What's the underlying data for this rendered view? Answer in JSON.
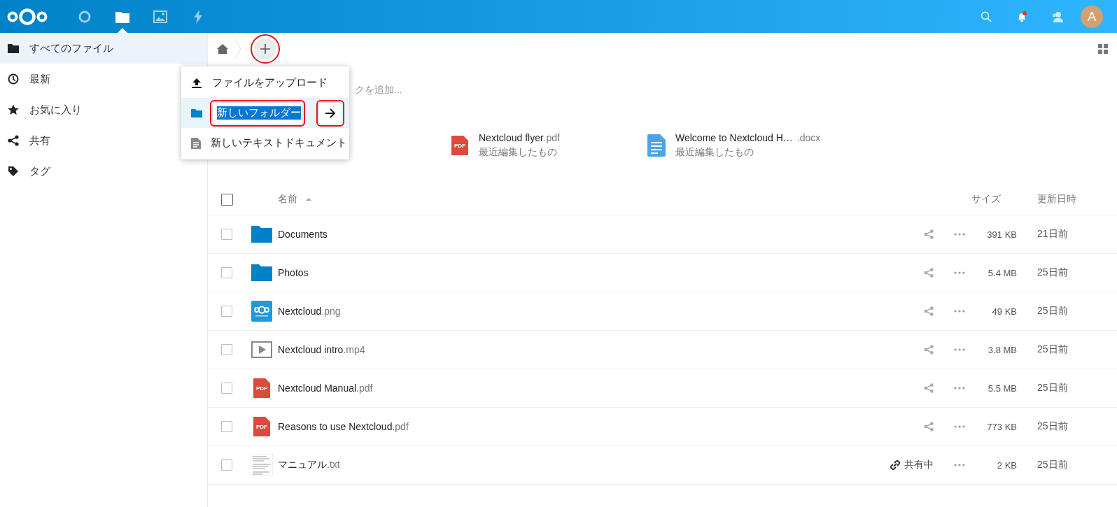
{
  "header": {
    "apps": [
      {
        "kind": "dashboard",
        "selected": false
      },
      {
        "kind": "files",
        "selected": true
      },
      {
        "kind": "photos",
        "selected": false
      },
      {
        "kind": "activity",
        "selected": false
      }
    ],
    "notifications_unread": true,
    "avatar": {
      "initial": "A"
    }
  },
  "sidebar": {
    "items": [
      {
        "kind": "all",
        "label": "すべてのファイル",
        "selected": true
      },
      {
        "kind": "recent",
        "label": "最新",
        "selected": false
      },
      {
        "kind": "favorites",
        "label": "お気に入り",
        "selected": false
      },
      {
        "kind": "shares",
        "label": "共有",
        "selected": false
      },
      {
        "kind": "tags",
        "label": "タグ",
        "selected": false
      }
    ]
  },
  "breadcrumb": {
    "new_button_highlighted": true
  },
  "new_menu": {
    "items": [
      {
        "kind": "upload",
        "label": "ファイルをアップロード",
        "selected": false
      },
      {
        "kind": "folder",
        "value": "新しいフォルダー",
        "text_selected": true,
        "highlighted": true,
        "submit_highlighted": true,
        "selected": true
      },
      {
        "kind": "text",
        "label": "新しいテキストドキュメント",
        "selected": false
      }
    ]
  },
  "description": {
    "visible_text": "クを追加..."
  },
  "recent": [
    {
      "kind": "pdf",
      "icon_text": "PDF",
      "name": "Nextcloud flyer",
      "ext": ".pdf",
      "subtitle": "最近編集したもの"
    },
    {
      "kind": "doc",
      "name": "Welcome to Nextcloud H…",
      "ext": ".docx",
      "subtitle": "最近編集したもの"
    }
  ],
  "table": {
    "select_all_checked": false,
    "columns": [
      {
        "label": "名前",
        "sorted": true
      },
      {
        "label": "サイズ",
        "sorted": false
      },
      {
        "label": "更新日時",
        "sorted": false
      }
    ],
    "rows": [
      {
        "kind": "folder",
        "name": "Documents",
        "shared": false,
        "checked": false,
        "size": "391 KB",
        "modified": "21日前"
      },
      {
        "kind": "folder",
        "name": "Photos",
        "shared": false,
        "checked": false,
        "size": "5.4 MB",
        "modified": "25日前"
      },
      {
        "kind": "image",
        "name": "Nextcloud",
        "ext": ".png",
        "shared": false,
        "checked": false,
        "size": "49 KB",
        "modified": "25日前"
      },
      {
        "kind": "video",
        "name": "Nextcloud intro",
        "ext": ".mp4",
        "shared": false,
        "checked": false,
        "size": "3.8 MB",
        "modified": "25日前"
      },
      {
        "kind": "pdf",
        "icon_text": "PDF",
        "name": "Nextcloud Manual",
        "ext": ".pdf",
        "shared": false,
        "checked": false,
        "size": "5.5 MB",
        "modified": "25日前"
      },
      {
        "kind": "pdf",
        "icon_text": "PDF",
        "name": "Reasons to use Nextcloud",
        "ext": ".pdf",
        "shared": false,
        "checked": false,
        "size": "773 KB",
        "modified": "25日前"
      },
      {
        "kind": "txt",
        "name": "マニュアル",
        "ext": ".txt",
        "shared": true,
        "share_label": "共有中",
        "checked": false,
        "size": "2 KB",
        "modified": "25日前"
      }
    ]
  }
}
